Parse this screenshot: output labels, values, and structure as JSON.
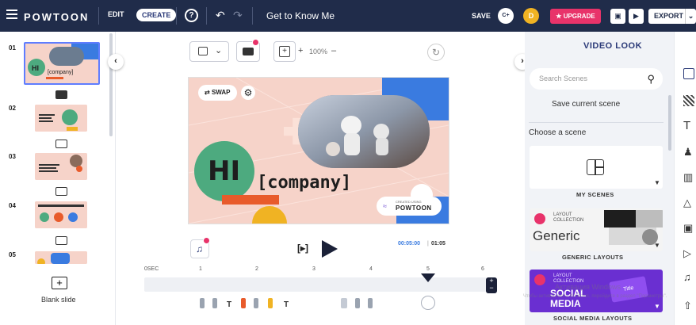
{
  "topbar": {
    "logo": "POWTOON",
    "edit_label": "EDIT",
    "create_label": "CREATE",
    "help_icon": "help-icon",
    "title": "Get to Know Me",
    "save_label": "SAVE",
    "avatar1_text": "C+",
    "avatar2_text": "D",
    "upgrade_label": "UPGRADE",
    "export_label": "EXPORT",
    "accent": "#202c4a"
  },
  "slides": {
    "items": [
      {
        "number": "01"
      },
      {
        "number": "02"
      },
      {
        "number": "03"
      },
      {
        "number": "04"
      },
      {
        "number": "05"
      }
    ],
    "blank_label": "Blank slide"
  },
  "toolbar": {
    "zoom_label": "100%",
    "plus": "+",
    "minus": "–"
  },
  "stage": {
    "swap_label": "SWAP",
    "hi_text": "HI",
    "company_text": "[company]",
    "created_using": "CREATED USING",
    "brand": "POWTOON"
  },
  "player": {
    "current_time": "00:05:00",
    "total_time": "01:05",
    "bracket_icon": "[▸]"
  },
  "timeline": {
    "labels": [
      "0SEC",
      "1",
      "2",
      "3",
      "4",
      "5",
      "6"
    ]
  },
  "rightpanel": {
    "title": "VIDEO LOOK",
    "search_placeholder": "Search Scenes",
    "save_scene": "Save current scene",
    "choose_scene": "Choose a scene",
    "cards": [
      {
        "label": "MY SCENES"
      },
      {
        "label": "GENERIC LAYOUTS",
        "kicker": "LAYOUT COLLECTION",
        "name": "Generic"
      },
      {
        "label": "SOCIAL MEDIA LAYOUTS",
        "kicker": "LAYOUT COLLECTION",
        "name": "SOCIAL MEDIA",
        "title_tag": "Title"
      }
    ]
  },
  "watermark": {
    "line1": "Активация Windows",
    "line2": "Чтобы активировать Windows, перейдите в раздел \"Параметры\"."
  }
}
